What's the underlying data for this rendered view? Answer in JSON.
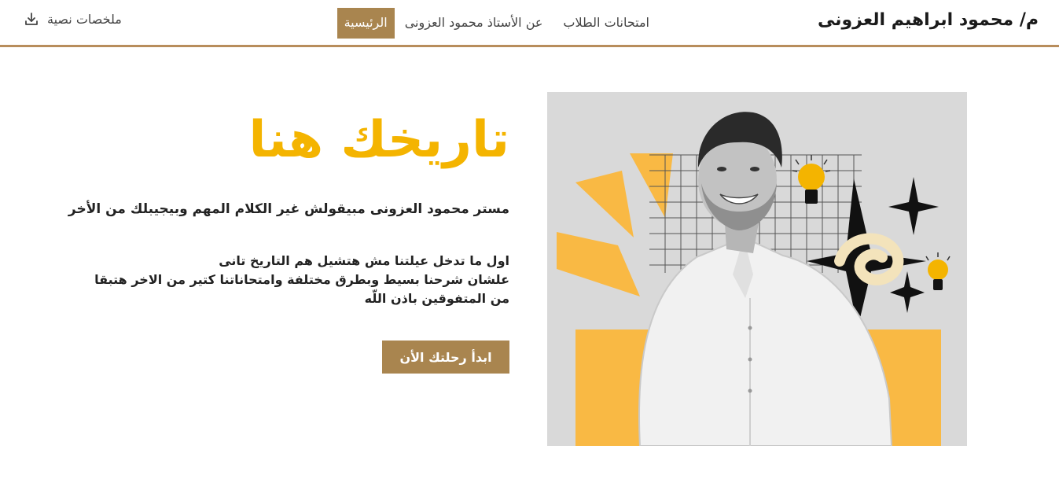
{
  "navbar": {
    "brand": "م/ محمود ابراهيم العزونى",
    "links": [
      {
        "label": "الرئيسية"
      },
      {
        "label": "عن الأستاذ محمود العزونى"
      },
      {
        "label": "امتحانات الطلاب"
      }
    ],
    "download_label": "ملخصات نصية",
    "download_icon": "download-icon"
  },
  "hero": {
    "title": "تاريخك هنا",
    "subtitle": "مستر محمود العزونى مبيقولش غير الكلام المهم وبيجيبلك من الأخر",
    "paragraph": [
      "اول ما تدخل عيلتنا مش هتشيل هم التاريخ تانى",
      "علشان شرحنا بسيط وبطرق مختلفة وامتحاناتنا كتير من الاخر هتبقا",
      "من المتفوقين باذن اللّه"
    ],
    "cta_label": "ابدأ رحلتك الأن"
  },
  "colors": {
    "accent": "#a9854f",
    "title": "#f4b400",
    "border": "#b88d5c",
    "shape_yellow": "#f9b944"
  }
}
